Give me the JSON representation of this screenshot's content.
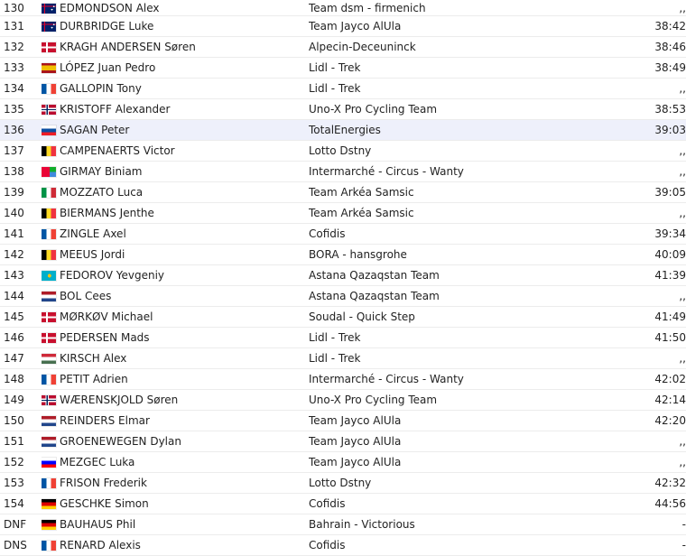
{
  "rows": [
    {
      "rank": "130",
      "country": "au",
      "rider": "EDMONDSON Alex",
      "team": "Team dsm - firmenich",
      "time": ",,"
    },
    {
      "rank": "131",
      "country": "au",
      "rider": "DURBRIDGE Luke",
      "team": "Team Jayco AlUla",
      "time": "38:42"
    },
    {
      "rank": "132",
      "country": "dk",
      "rider": "KRAGH ANDERSEN Søren",
      "team": "Alpecin-Deceuninck",
      "time": "38:46"
    },
    {
      "rank": "133",
      "country": "es",
      "rider": "LÓPEZ Juan Pedro",
      "team": "Lidl - Trek",
      "time": "38:49"
    },
    {
      "rank": "134",
      "country": "fr",
      "rider": "GALLOPIN Tony",
      "team": "Lidl - Trek",
      "time": ",,"
    },
    {
      "rank": "135",
      "country": "no",
      "rider": "KRISTOFF Alexander",
      "team": "Uno-X Pro Cycling Team",
      "time": "38:53"
    },
    {
      "rank": "136",
      "country": "sk",
      "rider": "SAGAN Peter",
      "team": "TotalEnergies",
      "time": "39:03",
      "highlight": true
    },
    {
      "rank": "137",
      "country": "be",
      "rider": "CAMPENAERTS Victor",
      "team": "Lotto Dstny",
      "time": ",,"
    },
    {
      "rank": "138",
      "country": "er",
      "rider": "GIRMAY Biniam",
      "team": "Intermarché - Circus - Wanty",
      "time": ",,"
    },
    {
      "rank": "139",
      "country": "it",
      "rider": "MOZZATO Luca",
      "team": "Team Arkéa Samsic",
      "time": "39:05"
    },
    {
      "rank": "140",
      "country": "be",
      "rider": "BIERMANS Jenthe",
      "team": "Team Arkéa Samsic",
      "time": ",,"
    },
    {
      "rank": "141",
      "country": "fr",
      "rider": "ZINGLE Axel",
      "team": "Cofidis",
      "time": "39:34"
    },
    {
      "rank": "142",
      "country": "be",
      "rider": "MEEUS Jordi",
      "team": "BORA - hansgrohe",
      "time": "40:09"
    },
    {
      "rank": "143",
      "country": "kz",
      "rider": "FEDOROV Yevgeniy",
      "team": "Astana Qazaqstan Team",
      "time": "41:39"
    },
    {
      "rank": "144",
      "country": "nl",
      "rider": "BOL Cees",
      "team": "Astana Qazaqstan Team",
      "time": ",,"
    },
    {
      "rank": "145",
      "country": "dk",
      "rider": "MØRKØV Michael",
      "team": "Soudal - Quick Step",
      "time": "41:49"
    },
    {
      "rank": "146",
      "country": "dk",
      "rider": "PEDERSEN Mads",
      "team": "Lidl - Trek",
      "time": "41:50"
    },
    {
      "rank": "147",
      "country": "hu",
      "rider": "KIRSCH Alex",
      "team": "Lidl - Trek",
      "time": ",,"
    },
    {
      "rank": "148",
      "country": "fr",
      "rider": "PETIT Adrien",
      "team": "Intermarché - Circus - Wanty",
      "time": "42:02"
    },
    {
      "rank": "149",
      "country": "no",
      "rider": "WÆRENSKJOLD Søren",
      "team": "Uno-X Pro Cycling Team",
      "time": "42:14"
    },
    {
      "rank": "150",
      "country": "nl",
      "rider": "REINDERS Elmar",
      "team": "Team Jayco AlUla",
      "time": "42:20"
    },
    {
      "rank": "151",
      "country": "nl",
      "rider": "GROENEWEGEN Dylan",
      "team": "Team Jayco AlUla",
      "time": ",,"
    },
    {
      "rank": "152",
      "country": "si",
      "rider": "MEZGEC Luka",
      "team": "Team Jayco AlUla",
      "time": ",,"
    },
    {
      "rank": "153",
      "country": "fr",
      "rider": "FRISON Frederik",
      "team": "Lotto Dstny",
      "time": "42:32"
    },
    {
      "rank": "154",
      "country": "de",
      "rider": "GESCHKE Simon",
      "team": "Cofidis",
      "time": "44:56"
    },
    {
      "rank": "DNF",
      "country": "de",
      "rider": "BAUHAUS Phil",
      "team": "Bahrain - Victorious",
      "time": "-"
    },
    {
      "rank": "DNS",
      "country": "fr",
      "rider": "RENARD Alexis",
      "team": "Cofidis",
      "time": "-"
    }
  ],
  "flag_colors": {
    "au": {
      "bg": "#012169",
      "accent": "#e4002b"
    },
    "dk": {
      "bg": "#c8102e",
      "accent": "#ffffff"
    },
    "es": {
      "bg": "#aa151b",
      "accent": "#f1bf00"
    },
    "fr": [
      "#0055a4",
      "#ffffff",
      "#ef4135"
    ],
    "no": {
      "bg": "#ba0c2f",
      "accent": "#ffffff",
      "inner": "#00205b"
    },
    "sk": [
      "#ffffff",
      "#0b4ea2",
      "#ee1c25"
    ],
    "be": [
      "#000000",
      "#fdda24",
      "#ef3340"
    ],
    "er": {
      "green": "#12ad2b",
      "red": "#ea0437",
      "blue": "#4189dd"
    },
    "it": [
      "#009246",
      "#ffffff",
      "#ce2b37"
    ],
    "kz": {
      "bg": "#00afca",
      "accent": "#fec50c"
    },
    "nl": [
      "#ae1c28",
      "#ffffff",
      "#21468b"
    ],
    "hu": [
      "#ce2939",
      "#ffffff",
      "#477050"
    ],
    "si": [
      "#ffffff",
      "#0000ff",
      "#ff0000"
    ],
    "de": [
      "#000000",
      "#dd0000",
      "#ffce00"
    ]
  }
}
